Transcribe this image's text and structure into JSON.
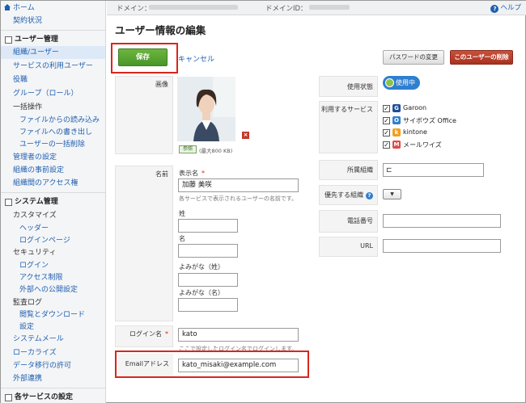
{
  "sidebar": {
    "home": "ホーム",
    "contract": "契約状況",
    "user_admin": "ユーザー管理",
    "items": [
      "組織/ユーザー",
      "サービスの利用ユーザー",
      "役職",
      "グループ（ロール）",
      "一括操作",
      "ファイルからの読み込み",
      "ファイルへの書き出し",
      "ユーザーの一括削除",
      "管理者の設定",
      "組織の事前設定",
      "組織間のアクセス権"
    ],
    "system_admin": "システム管理",
    "system_items": [
      "カスタマイズ",
      "ヘッダー",
      "ログインページ",
      "セキュリティ",
      "ログイン",
      "アクセス制限",
      "外部への公開設定",
      "監査ログ",
      "閲覧とダウンロード",
      "設定",
      "システムメール",
      "ローカライズ",
      "データ移行の許可",
      "外部連携"
    ],
    "services_settings": "各サービスの設定"
  },
  "topbar": {
    "domain_label": "ドメイン：",
    "domain_id_label": "ドメインID：",
    "help": "ヘルプ"
  },
  "main": {
    "title": "ユーザー情報の編集",
    "save": "保存",
    "cancel": "キャンセル",
    "password_change": "パスワードの変更",
    "delete_user": "このユーザーの削除"
  },
  "form": {
    "image_label": "画像",
    "ref_button": "参照",
    "ref_hint": "(最大800 KB)",
    "name_label": "名前",
    "display_name_label": "表示名",
    "required_mark": "*",
    "display_name_value": "加藤 美咲",
    "display_name_hint": "各サービスで表示されるユーザーの名前です。",
    "last_name_label": "姓",
    "first_name_label": "名",
    "last_kana_label": "よみがな（姓）",
    "first_kana_label": "よみがな（名）",
    "login_label": "ログイン名",
    "login_value": "kato",
    "login_hint": "ここで設定したログイン名でログインします。",
    "email_label": "Emailアドレス",
    "email_value": "kato_misaki@example.com"
  },
  "right": {
    "status_label": "使用状態",
    "status_value": "使用中",
    "services_label": "利用するサービス",
    "services": [
      {
        "name": "Garoon",
        "icon": "G",
        "color": "#1f4e96",
        "checked": true
      },
      {
        "name": "サイボウズ Office",
        "icon": "O",
        "color": "#2f7fd0",
        "checked": true
      },
      {
        "name": "kintone",
        "icon": "k",
        "color": "#f0a020",
        "checked": true
      },
      {
        "name": "メールワイズ",
        "icon": "M",
        "color": "#e04848",
        "checked": true
      }
    ],
    "dept_label": "所属組織",
    "priority_label": "優先する組織",
    "phone_label": "電話番号",
    "url_label": "URL"
  },
  "colors": {
    "accent": "#1f5fae",
    "save_green": "#5aa632",
    "delete_red": "#b53b26",
    "highlight": "#d9261c"
  }
}
